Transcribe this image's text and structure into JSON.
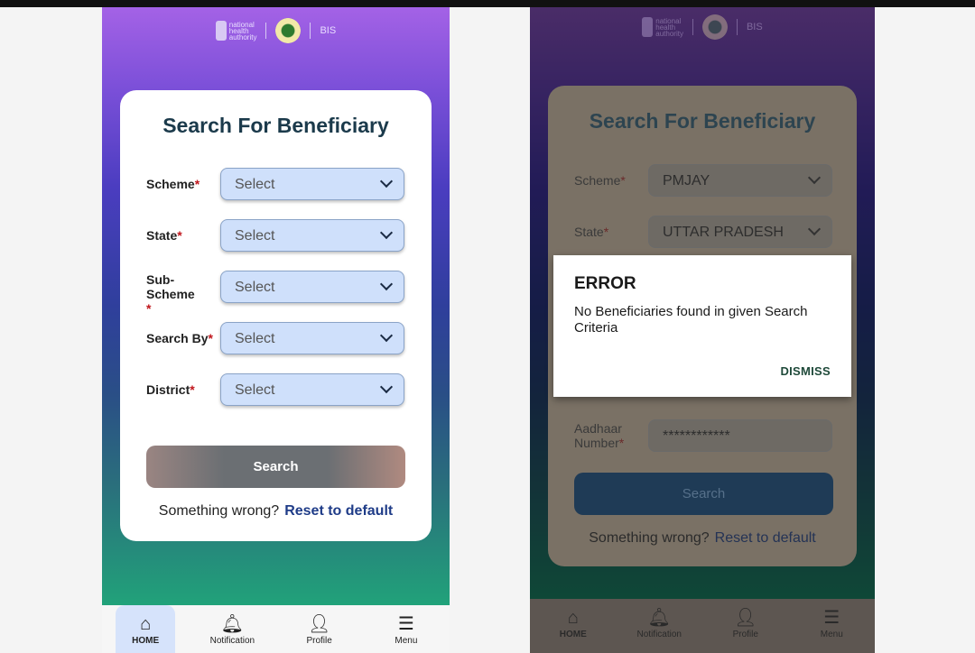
{
  "header": {
    "logo_text": "national health authority",
    "bis": "BIS"
  },
  "form": {
    "title": "Search For Beneficiary",
    "fields": [
      {
        "label": "Scheme",
        "value": "Select"
      },
      {
        "label": "State",
        "value": "Select"
      },
      {
        "label": "Sub-Scheme",
        "value": "Select"
      },
      {
        "label": "Search By",
        "value": "Select"
      },
      {
        "label": "District",
        "value": "Select"
      }
    ],
    "search_label": "Search",
    "wrong_text": "Something wrong?",
    "reset_label": "Reset to default"
  },
  "second_form": {
    "fields": [
      {
        "label": "Scheme",
        "value": "PMJAY"
      },
      {
        "label": "State",
        "value": "UTTAR PRADESH"
      },
      {
        "label": "Aadhaar Number",
        "value": "************"
      }
    ]
  },
  "dialog": {
    "title": "ERROR",
    "message": "No Beneficiaries found in given Search Criteria",
    "dismiss": "DISMISS"
  },
  "nav": [
    {
      "label": "HOME",
      "icon": "home-icon"
    },
    {
      "label": "Notification",
      "icon": "bell-icon"
    },
    {
      "label": "Profile",
      "icon": "user-icon"
    },
    {
      "label": "Menu",
      "icon": "menu-icon"
    }
  ]
}
